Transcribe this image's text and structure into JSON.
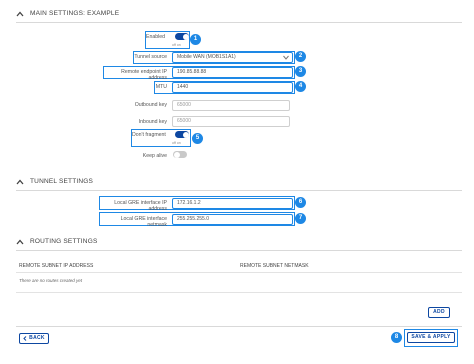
{
  "sections": {
    "main": {
      "title": "MAIN SETTINGS: EXAMPLE"
    },
    "tunnel": {
      "title": "TUNNEL SETTINGS"
    },
    "routing": {
      "title": "ROUTING SETTINGS"
    }
  },
  "main_settings": {
    "enabled": {
      "label": "Enabled",
      "state_on": "on",
      "state_off": "off",
      "value": true
    },
    "tunnel_source": {
      "label": "Tunnel source",
      "value": "Mobile WAN (MOB1S1A1)"
    },
    "remote_endpoint": {
      "label": "Remote endpoint IP address",
      "value": "190.85.88.88"
    },
    "mtu": {
      "label": "MTU",
      "value": "1440"
    },
    "outbound_key": {
      "label": "Outbound key",
      "placeholder": "65000"
    },
    "inbound_key": {
      "label": "Inbound key",
      "placeholder": "65000"
    },
    "dont_fragment": {
      "label": "Don't fragment",
      "state_on": "on",
      "state_off": "off",
      "value": true
    },
    "keep_alive": {
      "label": "Keep alive",
      "value": false
    }
  },
  "tunnel_settings": {
    "local_gre_ip": {
      "label": "Local GRE interface IP address",
      "value": "172.16.1.2"
    },
    "local_gre_netmask": {
      "label": "Local GRE interface netmask",
      "value": "255.255.255.0"
    }
  },
  "routing": {
    "columns": [
      "REMOTE SUBNET IP ADDRESS",
      "REMOTE SUBNET NETMASK"
    ],
    "empty_message": "There are no routes created yet"
  },
  "buttons": {
    "add": "ADD",
    "back": "BACK",
    "save_apply": "SAVE & APPLY"
  },
  "badges": [
    "1",
    "2",
    "3",
    "4",
    "5",
    "6",
    "7",
    "8"
  ],
  "colors": {
    "highlight": "#1e88e5",
    "toggle_on": "#0d47a1",
    "badge": "#1e88e5"
  }
}
